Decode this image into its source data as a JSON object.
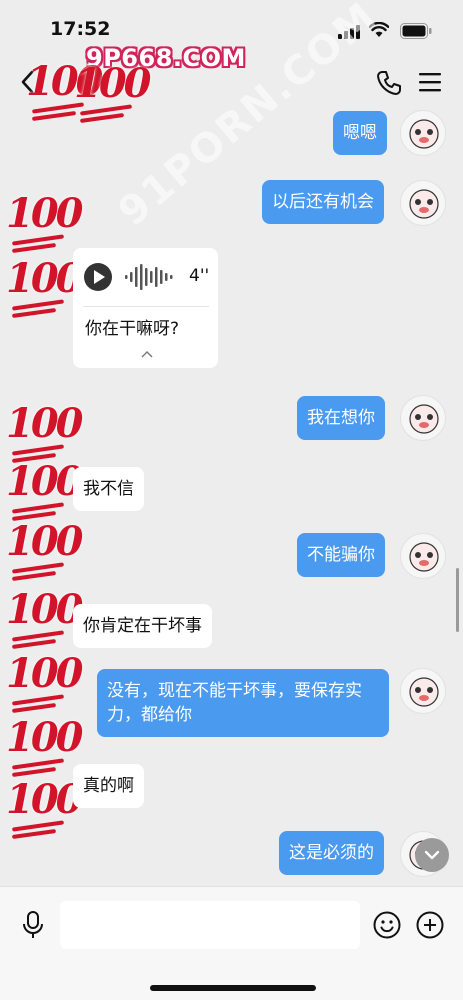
{
  "status_bar": {
    "time": "17:52"
  },
  "watermarks": {
    "logo": "9P668.COM",
    "diagonal": "91PORN.COM"
  },
  "header": {
    "back_icon": "chevron-left-icon",
    "call_icon": "phone-icon",
    "menu_icon": "hamburger-menu-icon"
  },
  "stickers": {
    "emoji": "hundred-points-emoji",
    "label": "100"
  },
  "messages": [
    {
      "side": "out",
      "text": "嗯嗯"
    },
    {
      "side": "out",
      "text": "以后还有机会"
    },
    {
      "side": "in",
      "type": "voice",
      "duration": "4''",
      "transcript": "你在干嘛呀?"
    },
    {
      "side": "out",
      "text": "我在想你"
    },
    {
      "side": "in",
      "text": "我不信"
    },
    {
      "side": "out",
      "text": "不能骗你"
    },
    {
      "side": "in",
      "text": "你肯定在干坏事"
    },
    {
      "side": "out",
      "text_line1": "没有，现在不能干坏事，要保存实",
      "text_line2": "力，都给你"
    },
    {
      "side": "in",
      "text": "真的啊"
    },
    {
      "side": "out",
      "text": "这是必须的"
    }
  ],
  "input_bar": {
    "placeholder": "",
    "mic_icon": "microphone-icon",
    "emoji_icon": "smiley-icon",
    "plus_icon": "plus-circle-icon"
  },
  "colors": {
    "background": "#ededed",
    "outgoing_bubble": "#4a9af0",
    "incoming_bubble": "#ffffff",
    "sticker_red": "#d2142a"
  }
}
